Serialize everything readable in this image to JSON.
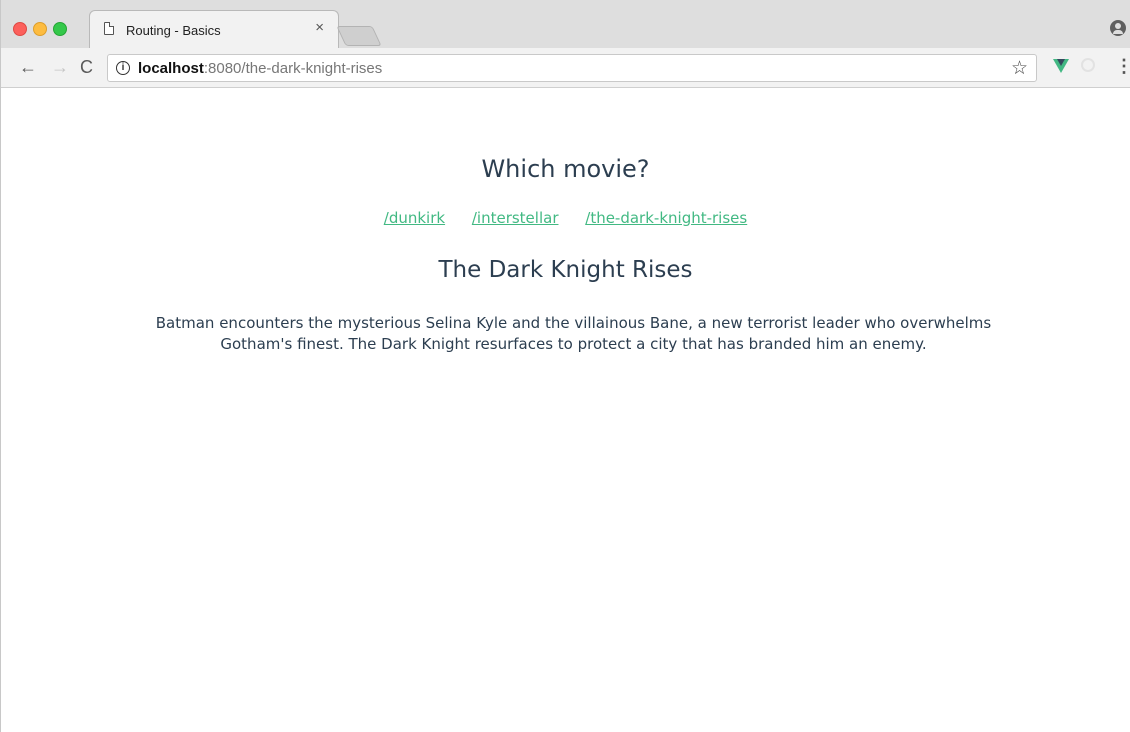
{
  "browser": {
    "tab": {
      "title": "Routing - Basics",
      "close": "×"
    },
    "nav": {
      "back": "←",
      "forward": "→",
      "reload": "C"
    },
    "address": {
      "host": "localhost",
      "rest": ":8080/the-dark-knight-rises"
    },
    "icons": {
      "info": "i",
      "star": "☆",
      "menu": "⋮"
    },
    "colors": {
      "vue_green": "#42b883",
      "vue_dark": "#35495e"
    }
  },
  "page": {
    "heading": "Which movie?",
    "links": [
      "/dunkirk",
      "/interstellar",
      "/the-dark-knight-rises"
    ],
    "movie": {
      "title": "The Dark Knight Rises",
      "description": "Batman encounters the mysterious Selina Kyle and the villainous Bane, a new terrorist leader who overwhelms Gotham's finest. The Dark Knight resurfaces to protect a city that has branded him an enemy."
    },
    "colors": {
      "text": "#2c3e50",
      "link": "#42b983"
    }
  }
}
